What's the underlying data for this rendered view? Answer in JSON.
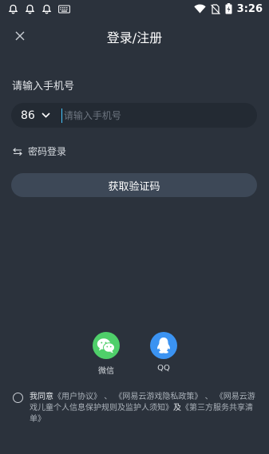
{
  "status_bar": {
    "time": "3:26",
    "icons": [
      "bell-outline-icon",
      "bell-outline-icon",
      "bell-outline-icon",
      "keyboard-icon",
      "wifi-icon",
      "no-sim-icon",
      "battery-charging-icon"
    ]
  },
  "header": {
    "title": "登录/注册",
    "close_icon": "close-icon"
  },
  "login": {
    "phone_label": "请输入手机号",
    "country_code": "86",
    "phone_placeholder": "请输入手机号",
    "password_login": "密码登录",
    "get_code_button": "获取验证码"
  },
  "social": {
    "wechat_label": "微信",
    "qq_label": "QQ"
  },
  "agreement": {
    "prefix": "我同意",
    "user_agreement": "《用户协议》",
    "sep1": "、",
    "privacy_policy": "《网易云游戏隐私政策》",
    "sep2": "、",
    "child_protection": "《网易云游戏儿童个人信息保护规则及监护人须知》",
    "and": "及",
    "third_party": "《第三方服务共享清单》"
  },
  "colors": {
    "background": "#2b323c",
    "input_bg": "#232a33",
    "button_bg": "#3d4857",
    "wechat": "#4fcf6a",
    "qq": "#3b93f2"
  }
}
